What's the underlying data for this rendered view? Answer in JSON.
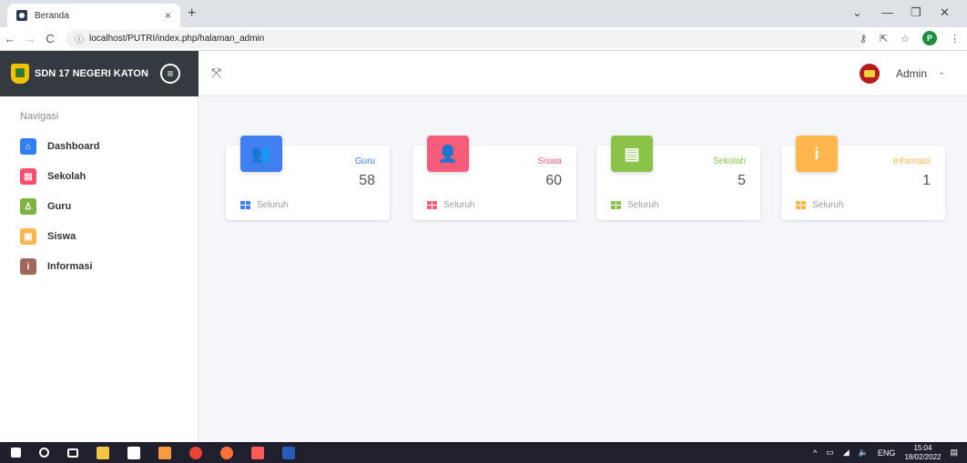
{
  "browser": {
    "tab_title": "Beranda",
    "tab_close": "×",
    "new_tab": "+",
    "url": "localhost/PUTRI/index.php/halaman_admin",
    "window_controls": [
      "⌄",
      "—",
      "❐",
      "✕"
    ],
    "profile_initial": "P"
  },
  "header": {
    "brand": "SDN 17 NEGERI KATON",
    "user": "Admin"
  },
  "sidebar": {
    "header": "Navigasi",
    "items": [
      {
        "label": "Dashboard",
        "icon": "home-icon",
        "color": "#2f80ed"
      },
      {
        "label": "Sekolah",
        "icon": "school-icon",
        "color": "#ff4d6d"
      },
      {
        "label": "Guru",
        "icon": "user-icon",
        "color": "#7cb342"
      },
      {
        "label": "Siswa",
        "icon": "id-card-icon",
        "color": "#ffb74d"
      },
      {
        "label": "Informasi",
        "icon": "info-icon",
        "color": "#a1675a"
      }
    ]
  },
  "cards": [
    {
      "title": "Guru",
      "value": "58",
      "footer": "Seluruh",
      "icon": "users-icon",
      "color": "#3f7ff0"
    },
    {
      "title": "Siswa",
      "value": "60",
      "footer": "Seluruh",
      "icon": "user-icon",
      "color": "#f45c7a"
    },
    {
      "title": "Sekolah",
      "value": "5",
      "footer": "Seluruh",
      "icon": "document-icon",
      "color": "#8bc34a"
    },
    {
      "title": "Informasi",
      "value": "1",
      "footer": "Seluruh",
      "icon": "info-icon",
      "color": "#ffb74d"
    }
  ],
  "taskbar": {
    "language": "ENG",
    "time": "15:04",
    "date": "18/02/2022"
  }
}
